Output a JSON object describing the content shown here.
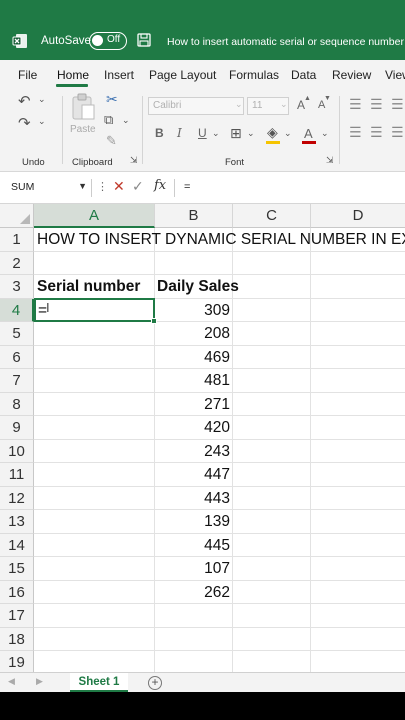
{
  "titlebar": {
    "autosave_label": "AutoSave",
    "toggle_state": "Off",
    "document_title": "How to insert automatic serial or sequence number in",
    "bg_color": "#1f7a45"
  },
  "menu": {
    "tabs": [
      "File",
      "Home",
      "Insert",
      "Page Layout",
      "Formulas",
      "Data",
      "Review",
      "View"
    ],
    "active": "Home"
  },
  "ribbon": {
    "undo_label": "Undo",
    "clipboard_label": "Clipboard",
    "paste_label": "Paste",
    "font_label": "Font",
    "font_name": "Calibri",
    "font_size": "11",
    "bold": "B",
    "italic": "I",
    "underline": "U",
    "grow_font": "A",
    "shrink_font": "A",
    "font_color": "A"
  },
  "formula_bar": {
    "name_box": "SUM",
    "fx": "fx",
    "content": "="
  },
  "grid": {
    "columns": [
      "A",
      "B",
      "C",
      "D"
    ],
    "rows": [
      "1",
      "2",
      "3",
      "4",
      "5",
      "6",
      "7",
      "8",
      "9",
      "10",
      "11",
      "12",
      "13",
      "14",
      "15",
      "16",
      "17",
      "18",
      "19"
    ],
    "selected_column": "A",
    "selected_row": "4",
    "a1": "HOW TO INSERT DYNAMIC SERIAL NUMBER IN EX",
    "header_serial": "Serial number",
    "header_sales": "Daily Sales",
    "active_cell_value": "=",
    "sales": [
      "309",
      "208",
      "469",
      "481",
      "271",
      "420",
      "243",
      "447",
      "443",
      "139",
      "445",
      "107",
      "262"
    ]
  },
  "sheets": {
    "active": "Sheet 1",
    "add": "+"
  }
}
